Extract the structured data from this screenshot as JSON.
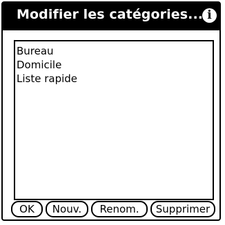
{
  "dialog": {
    "title": "Modifier les catégories...",
    "info_icon": "info-icon"
  },
  "categories": {
    "items": [
      {
        "label": "Bureau"
      },
      {
        "label": "Domicile"
      },
      {
        "label": "Liste rapide"
      }
    ]
  },
  "buttons": {
    "ok": "OK",
    "new": "Nouv.",
    "rename": "Renom.",
    "delete": "Supprimer"
  }
}
